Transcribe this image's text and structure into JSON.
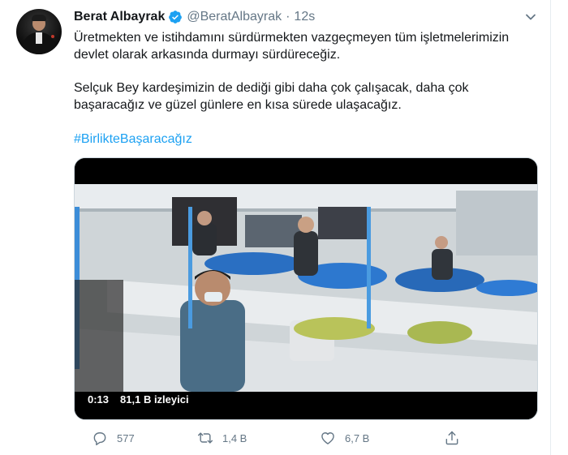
{
  "tweet": {
    "display_name": "Berat Albayrak",
    "handle": "@BeratAlbayrak",
    "separator": "·",
    "time": "12s",
    "lines": [
      "Üretmekten ve istihdamını sürdürmekten vazgeçmeyen tüm işletmelerimizin",
      "devlet olarak arkasında durmayı sürdüreceğiz.",
      "Selçuk Bey kardeşimizin de dediği gibi daha çok çalışacak, daha çok",
      "başaracağız ve güzel günlere en kısa sürede ulaşacağız."
    ],
    "hashtag": "#BirlikteBaşaracağız"
  },
  "video": {
    "time": "0:13",
    "views": "81,1 B izleyici"
  },
  "actions": {
    "replies": "577",
    "retweets": "1,4 B",
    "likes": "6,7 B"
  },
  "colors": {
    "verified": "#1da1f2",
    "hashtag": "#1da1f2",
    "muted": "#657786"
  },
  "icons": [
    "verified-badge-icon",
    "chevron-down-icon",
    "reply-icon",
    "retweet-icon",
    "like-icon",
    "share-icon"
  ]
}
